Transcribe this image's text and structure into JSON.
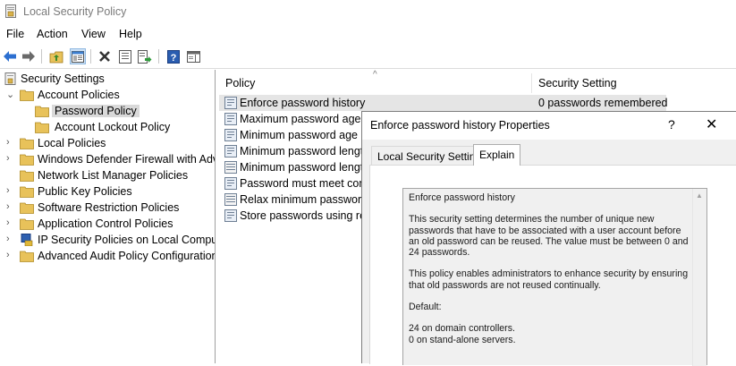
{
  "window": {
    "title": "Local Security Policy"
  },
  "menu": [
    "File",
    "Action",
    "View",
    "Help"
  ],
  "toolbar": {
    "buttons": [
      "back-arrow-icon",
      "forward-arrow-icon",
      "up-folder-icon",
      "show-hide-tree-icon",
      "delete-icon",
      "properties-icon",
      "export-list-icon",
      "help-icon",
      "show-action-pane-icon"
    ]
  },
  "tree": {
    "root": "Security Settings",
    "account_policies": "Account Policies",
    "password_policy": "Password Policy",
    "account_lockout_policy": "Account Lockout Policy",
    "local_policies": "Local Policies",
    "firewall": "Windows Defender Firewall with Adva",
    "network_list": "Network List Manager Policies",
    "public_key": "Public Key Policies",
    "software_restriction": "Software Restriction Policies",
    "application_control": "Application Control Policies",
    "ip_security": "IP Security Policies on Local Compute",
    "advanced_audit": "Advanced Audit Policy Configuration"
  },
  "list": {
    "col_policy": "Policy",
    "col_setting": "Security Setting",
    "rows": [
      {
        "name": "Enforce password history",
        "setting": "0 passwords remembered"
      },
      {
        "name": "Maximum password age",
        "setting": ""
      },
      {
        "name": "Minimum password age",
        "setting": ""
      },
      {
        "name": "Minimum password length",
        "setting": ""
      },
      {
        "name": "Minimum password length",
        "setting": ""
      },
      {
        "name": "Password must meet com",
        "setting": ""
      },
      {
        "name": "Relax minimum password",
        "setting": ""
      },
      {
        "name": "Store passwords using reve",
        "setting": ""
      }
    ]
  },
  "dialog": {
    "title": "Enforce password history Properties",
    "help": "?",
    "close": "✕",
    "tabs": [
      "Local Security Setting",
      "Explain"
    ],
    "active_tab": "Explain",
    "explain_text": "Enforce password history\n\nThis security setting determines the number of unique new passwords that have to be associated with a user account before an old password can be reused. The value must be between 0 and 24 passwords.\n\nThis policy enables administrators to enhance security by ensuring that old passwords are not reused continually.\n\nDefault:\n\n24 on domain controllers.\n0 on stand-alone servers."
  },
  "colors": {
    "selection": "#d9d9d9",
    "row_highlight": "#e5e5e5",
    "folder": "#e8c25a",
    "accent": "#1e66c8"
  }
}
